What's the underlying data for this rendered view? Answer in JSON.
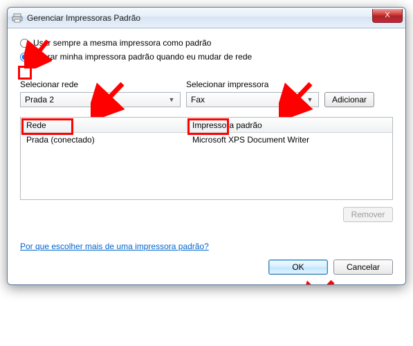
{
  "window": {
    "title": "Gerenciar Impressoras Padrão"
  },
  "radios": {
    "option1": "Usar sempre a mesma impressora como padrão",
    "option2": "Alterar minha impressora padrão quando eu mudar de rede"
  },
  "labels": {
    "select_network": "Selecionar rede",
    "select_printer": "Selecionar impressora"
  },
  "combos": {
    "network_value": "Prada  2",
    "printer_value": "Fax"
  },
  "buttons": {
    "add": "Adicionar",
    "remove": "Remover",
    "ok": "OK",
    "cancel": "Cancelar"
  },
  "table": {
    "headers": {
      "network": "Rede",
      "printer": "Impressora padrão"
    },
    "rows": [
      {
        "network": "Prada (conectado)",
        "printer": "Microsoft XPS Document Writer"
      }
    ]
  },
  "link": "Por que escolher mais de uma impressora padrão?",
  "close_glyph": "X"
}
